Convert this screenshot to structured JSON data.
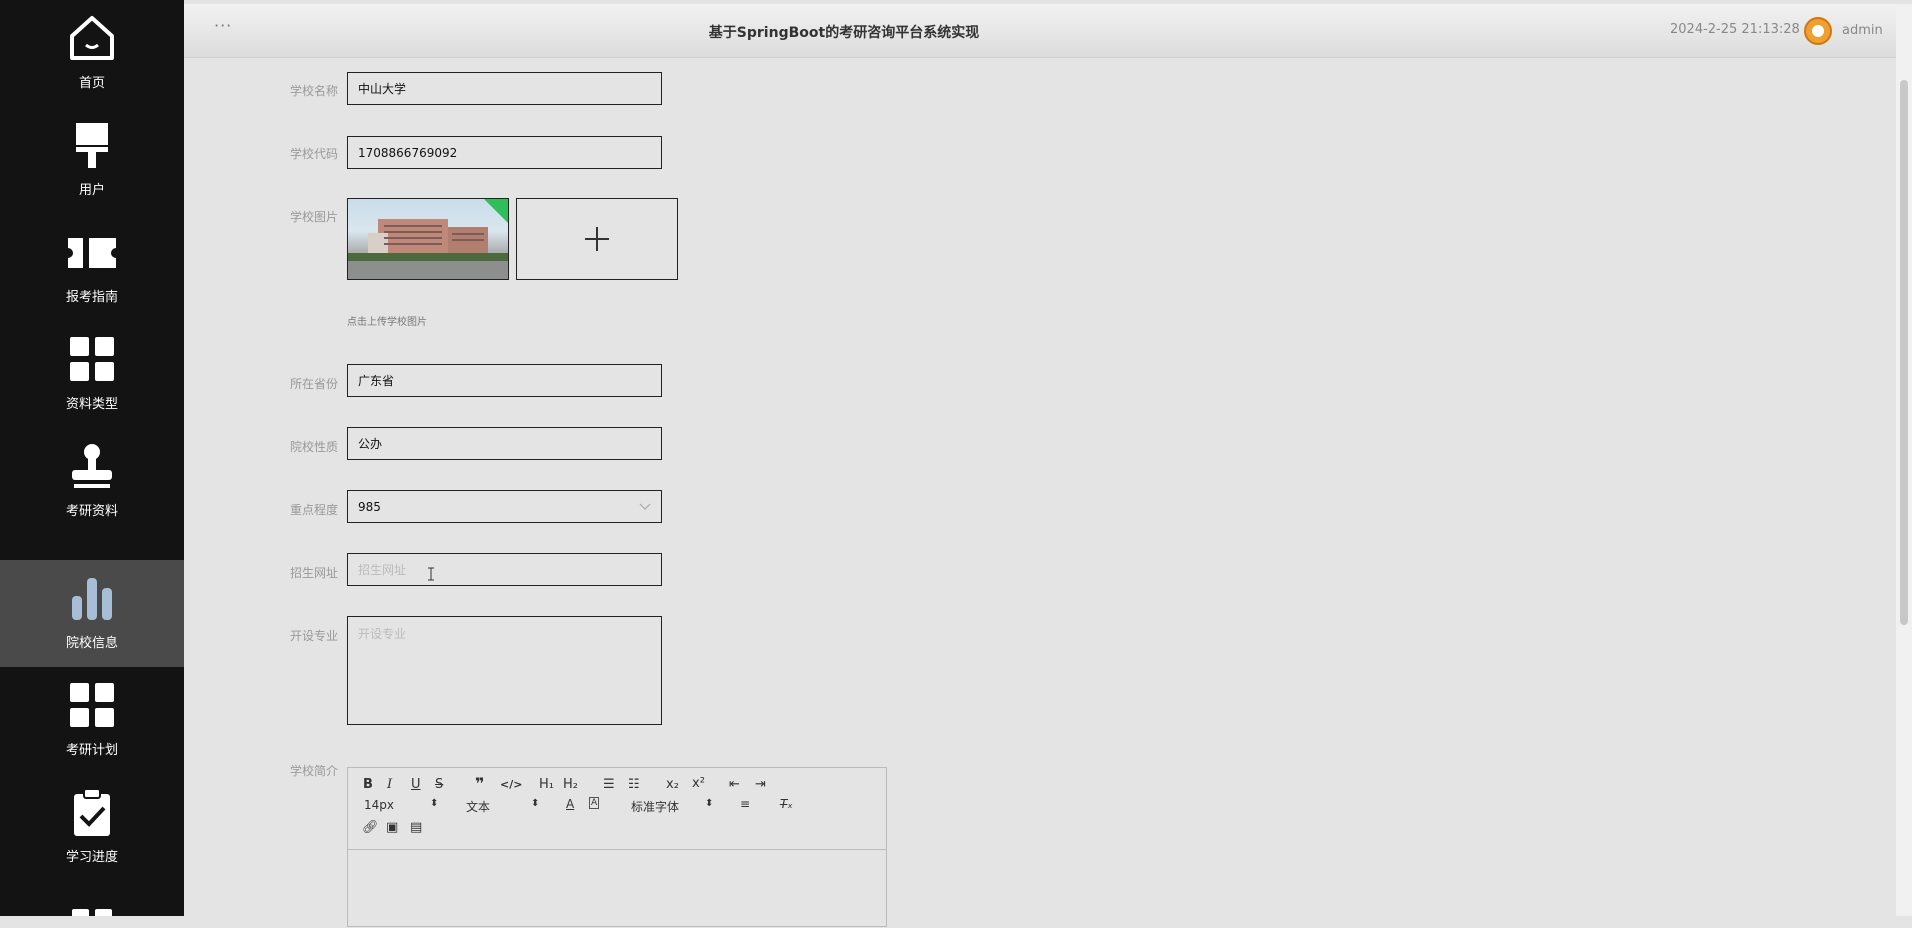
{
  "sidebar": {
    "items": [
      {
        "label": "首页",
        "icon": "home-icon"
      },
      {
        "label": "用户",
        "icon": "brush-icon"
      },
      {
        "label": "报考指南",
        "icon": "ticket-icon"
      },
      {
        "label": "资料类型",
        "icon": "grid-icon"
      },
      {
        "label": "考研资料",
        "icon": "stamp-icon"
      },
      {
        "label": "院校信息",
        "icon": "bar-chart-icon",
        "active": true
      },
      {
        "label": "考研计划",
        "icon": "grid-icon"
      },
      {
        "label": "学习进度",
        "icon": "clipboard-check-icon"
      }
    ]
  },
  "header": {
    "menu": "···",
    "title": "基于SpringBoot的考研咨询平台系统实现",
    "datetime": "2024-2-25 21:13:28",
    "user": "admin"
  },
  "form": {
    "school_name": {
      "label": "学校名称",
      "value": "中山大学"
    },
    "school_code": {
      "label": "学校代码",
      "value": "1708866769092"
    },
    "school_image": {
      "label": "学校图片",
      "hint": "点击上传学校图片"
    },
    "province": {
      "label": "所在省份",
      "value": "广东省"
    },
    "nature": {
      "label": "院校性质",
      "value": "公办"
    },
    "key_level": {
      "label": "重点程度",
      "value": "985"
    },
    "website": {
      "label": "招生网址",
      "placeholder": "招生网址",
      "value": ""
    },
    "majors": {
      "label": "开设专业",
      "placeholder": "开设专业",
      "value": ""
    },
    "intro": {
      "label": "学校简介"
    }
  },
  "editor": {
    "font_size": "14px",
    "block_type": "文本",
    "font_family": "标准字体"
  },
  "colors": {
    "sidebar_bg": "#131313",
    "active_bg": "#4a4a4a",
    "page_bg": "#e4e4e4"
  }
}
